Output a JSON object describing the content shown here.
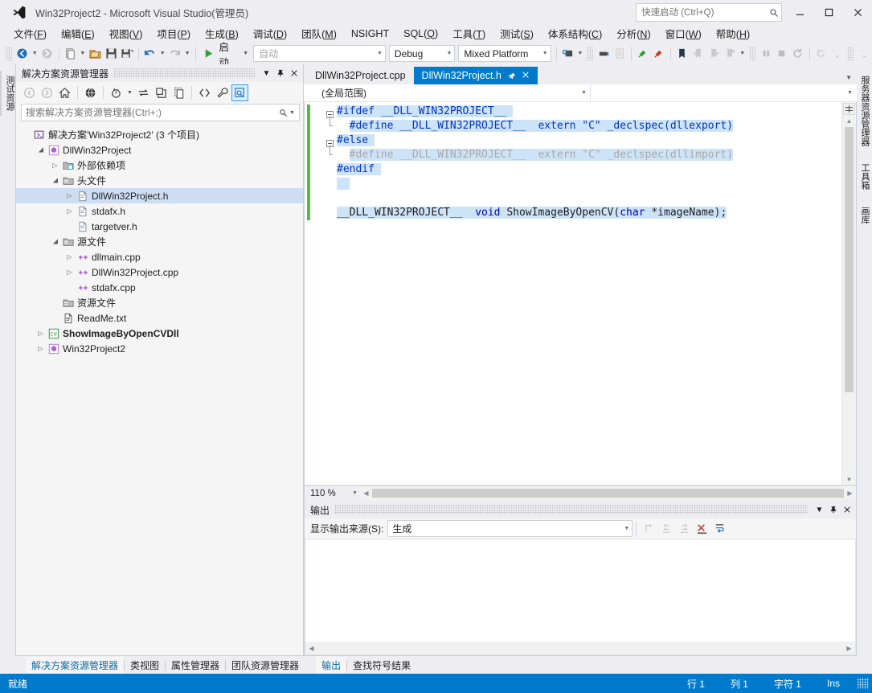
{
  "window": {
    "title": "Win32Project2 - Microsoft Visual Studio(管理员)",
    "quick_launch_placeholder": "快速启动 (Ctrl+Q)",
    "minimize": "minimize-icon",
    "maximize": "maximize-icon",
    "close": "close-icon",
    "accent": "#007acc"
  },
  "menu": {
    "items": [
      {
        "label": "文件",
        "key": "F"
      },
      {
        "label": "编辑",
        "key": "E"
      },
      {
        "label": "视图",
        "key": "V"
      },
      {
        "label": "项目",
        "key": "P"
      },
      {
        "label": "生成",
        "key": "B"
      },
      {
        "label": "调试",
        "key": "D"
      },
      {
        "label": "团队",
        "key": "M"
      },
      {
        "label": "NSIGHT",
        "key": ""
      },
      {
        "label": "SQL",
        "key": "Q"
      },
      {
        "label": "工具",
        "key": "T"
      },
      {
        "label": "测试",
        "key": "S"
      },
      {
        "label": "体系结构",
        "key": "C"
      },
      {
        "label": "分析",
        "key": "N"
      },
      {
        "label": "窗口",
        "key": "W"
      },
      {
        "label": "帮助",
        "key": "H"
      }
    ]
  },
  "toolbar": {
    "start_label": "启动",
    "config_placeholder": "自动",
    "config_value": "",
    "solution_config": "Debug",
    "solution_platform": "Mixed Platform"
  },
  "left_rail": {
    "tabs": [
      "测试资源"
    ]
  },
  "right_rail": {
    "tabs": [
      "服务器资源管理器",
      "工具箱",
      "画库"
    ]
  },
  "solution_explorer": {
    "title": "解决方案资源管理器",
    "search_placeholder": "搜索解决方案资源管理器(Ctrl+;)",
    "toolbar_icons": [
      "back-icon",
      "forward-icon",
      "home-icon",
      "web-icon",
      "pending-changes-icon",
      "sync-icon",
      "collapse-all-icon",
      "show-all-files-icon",
      "code-view-icon",
      "properties-icon",
      "preview-selected-items-icon"
    ],
    "tree": [
      {
        "label": "解决方案'Win32Project2' (3 个项目)",
        "depth": 0,
        "expander": "",
        "icon": "solution-icon",
        "selected": false,
        "bold": false
      },
      {
        "label": "DllWin32Project",
        "depth": 1,
        "expander": "open",
        "icon": "cpp-project-icon",
        "selected": false,
        "bold": false
      },
      {
        "label": "外部依赖项",
        "depth": 2,
        "expander": "closed",
        "icon": "folder-ref-icon",
        "selected": false,
        "bold": false
      },
      {
        "label": "头文件",
        "depth": 2,
        "expander": "open",
        "icon": "filter-folder-icon",
        "selected": false,
        "bold": false
      },
      {
        "label": "DllWin32Project.h",
        "depth": 3,
        "expander": "closed",
        "icon": "header-file-icon",
        "selected": true,
        "bold": false
      },
      {
        "label": "stdafx.h",
        "depth": 3,
        "expander": "closed",
        "icon": "header-file-icon",
        "selected": false,
        "bold": false
      },
      {
        "label": "targetver.h",
        "depth": 3,
        "expander": "",
        "icon": "header-file-icon",
        "selected": false,
        "bold": false
      },
      {
        "label": "源文件",
        "depth": 2,
        "expander": "open",
        "icon": "filter-folder-icon",
        "selected": false,
        "bold": false
      },
      {
        "label": "dllmain.cpp",
        "depth": 3,
        "expander": "closed",
        "icon": "cpp-file-icon",
        "selected": false,
        "bold": false
      },
      {
        "label": "DllWin32Project.cpp",
        "depth": 3,
        "expander": "closed",
        "icon": "cpp-file-icon",
        "selected": false,
        "bold": false
      },
      {
        "label": "stdafx.cpp",
        "depth": 3,
        "expander": "",
        "icon": "cpp-file-icon",
        "selected": false,
        "bold": false
      },
      {
        "label": "资源文件",
        "depth": 2,
        "expander": "",
        "icon": "filter-folder-icon",
        "selected": false,
        "bold": false
      },
      {
        "label": "ReadMe.txt",
        "depth": 2,
        "expander": "",
        "icon": "text-file-icon",
        "selected": false,
        "bold": false
      },
      {
        "label": "ShowImageByOpenCVDll",
        "depth": 1,
        "expander": "closed",
        "icon": "csharp-project-icon",
        "selected": false,
        "bold": true
      },
      {
        "label": "Win32Project2",
        "depth": 1,
        "expander": "closed",
        "icon": "cpp-project-icon",
        "selected": false,
        "bold": false
      }
    ]
  },
  "editor": {
    "tabs": [
      {
        "label": "DllWin32Project.cpp",
        "active": false
      },
      {
        "label": "DllWin32Project.h",
        "active": true
      }
    ],
    "active_tab_pin": "pin-icon",
    "active_tab_close": "close-icon",
    "scope_combo": "(全局范围)",
    "member_combo": "",
    "zoom": "110 %",
    "lines": [
      [
        {
          "t": "#ifdef __DLL_WIN32PROJECT__ ",
          "c": "pp",
          "sel": true
        }
      ],
      [
        {
          "t": "  ",
          "c": "plain",
          "sel": false
        },
        {
          "t": "#define __DLL_WIN32PROJECT__  extern \"C\" _declspec(dllexport)",
          "c": "pp",
          "sel": true
        }
      ],
      [
        {
          "t": "#else ",
          "c": "pp",
          "sel": true
        }
      ],
      [
        {
          "t": "  ",
          "c": "plain",
          "sel": false
        },
        {
          "t": "#define __DLL_WIN32PROJECT__  extern \"C\" _declspec(dllimport)",
          "c": "dim",
          "sel": true
        }
      ],
      [
        {
          "t": "#endif ",
          "c": "pp",
          "sel": true
        }
      ],
      [
        {
          "t": "  ",
          "c": "plain",
          "sel": true
        }
      ],
      [
        {
          "t": "",
          "c": "plain",
          "sel": false
        }
      ],
      [
        {
          "t": "__DLL_WIN32PROJECT__  ",
          "c": "plain",
          "sel": true
        },
        {
          "t": "void",
          "c": "kw",
          "sel": true
        },
        {
          "t": " ShowImageByOpenCV(",
          "c": "plain",
          "sel": true
        },
        {
          "t": "char",
          "c": "kw",
          "sel": true
        },
        {
          "t": " *imageName);",
          "c": "plain",
          "sel": true
        }
      ]
    ]
  },
  "output": {
    "title": "输出",
    "source_label": "显示输出来源(S):",
    "source_value": "生成",
    "toolbar_icons": [
      "goto-message-icon",
      "prev-message-icon",
      "next-message-icon",
      "clear-all-icon",
      "toggle-wordwrap-icon"
    ],
    "content": ""
  },
  "bottom_tabs": [
    {
      "label": "解决方案资源管理器",
      "active": true,
      "group": 0
    },
    {
      "label": "类视图",
      "active": false,
      "group": 0
    },
    {
      "label": "属性管理器",
      "active": false,
      "group": 0
    },
    {
      "label": "团队资源管理器",
      "active": false,
      "group": 0
    },
    {
      "label": "输出",
      "active": true,
      "group": 1
    },
    {
      "label": "查找符号结果",
      "active": false,
      "group": 1
    }
  ],
  "status": {
    "ready": "就绪",
    "line": "行 1",
    "col": "列 1",
    "ch": "字符 1",
    "mode": "Ins"
  }
}
